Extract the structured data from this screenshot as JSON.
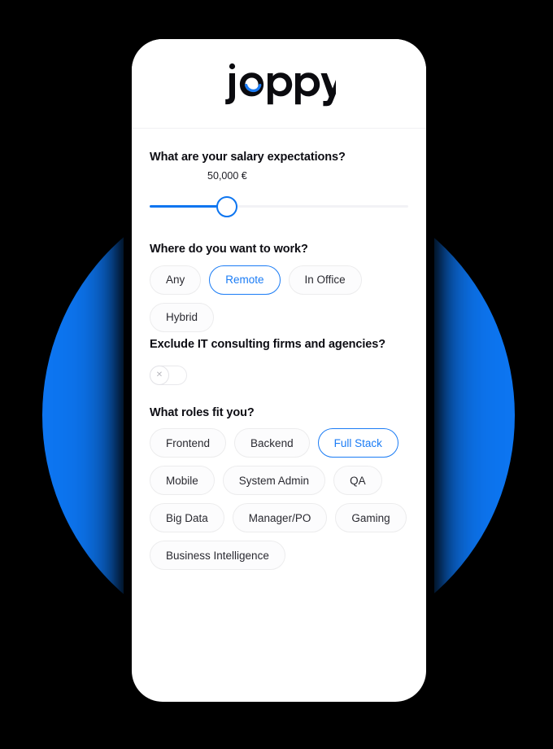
{
  "brand": {
    "logo_text": "joppy",
    "accent_color": "#0d75f0",
    "smile_color": "#1b7cf5"
  },
  "background": {
    "page_color": "#000000",
    "circle_color": "#0d75f0"
  },
  "screen": {
    "sections": [
      {
        "id": "salary",
        "title": "What are your salary expectations?",
        "control": "slider",
        "value_label": "50,000 €",
        "fill_percent": 30
      },
      {
        "id": "work-location",
        "title": "Where do you want to work?",
        "control": "chips",
        "options": [
          {
            "label": "Any",
            "selected": false
          },
          {
            "label": "Remote",
            "selected": true
          },
          {
            "label": "In Office",
            "selected": false
          },
          {
            "label": "Hybrid",
            "selected": false
          }
        ]
      },
      {
        "id": "exclude-consulting",
        "title": "Exclude IT consulting firms and agencies?",
        "control": "toggle",
        "toggle_state": "off",
        "toggle_icon": "close-x-icon",
        "toggle_glyph": "✕"
      },
      {
        "id": "roles",
        "title": "What roles fit you?",
        "control": "chips",
        "options": [
          {
            "label": "Frontend",
            "selected": false
          },
          {
            "label": "Backend",
            "selected": false
          },
          {
            "label": "Full Stack",
            "selected": true
          },
          {
            "label": "Mobile",
            "selected": false
          },
          {
            "label": "System Admin",
            "selected": false
          },
          {
            "label": "QA",
            "selected": false
          },
          {
            "label": "Big Data",
            "selected": false
          },
          {
            "label": "Manager/PO",
            "selected": false
          },
          {
            "label": "Gaming",
            "selected": false
          },
          {
            "label": "Business Intelligence",
            "selected": false
          }
        ]
      }
    ]
  }
}
